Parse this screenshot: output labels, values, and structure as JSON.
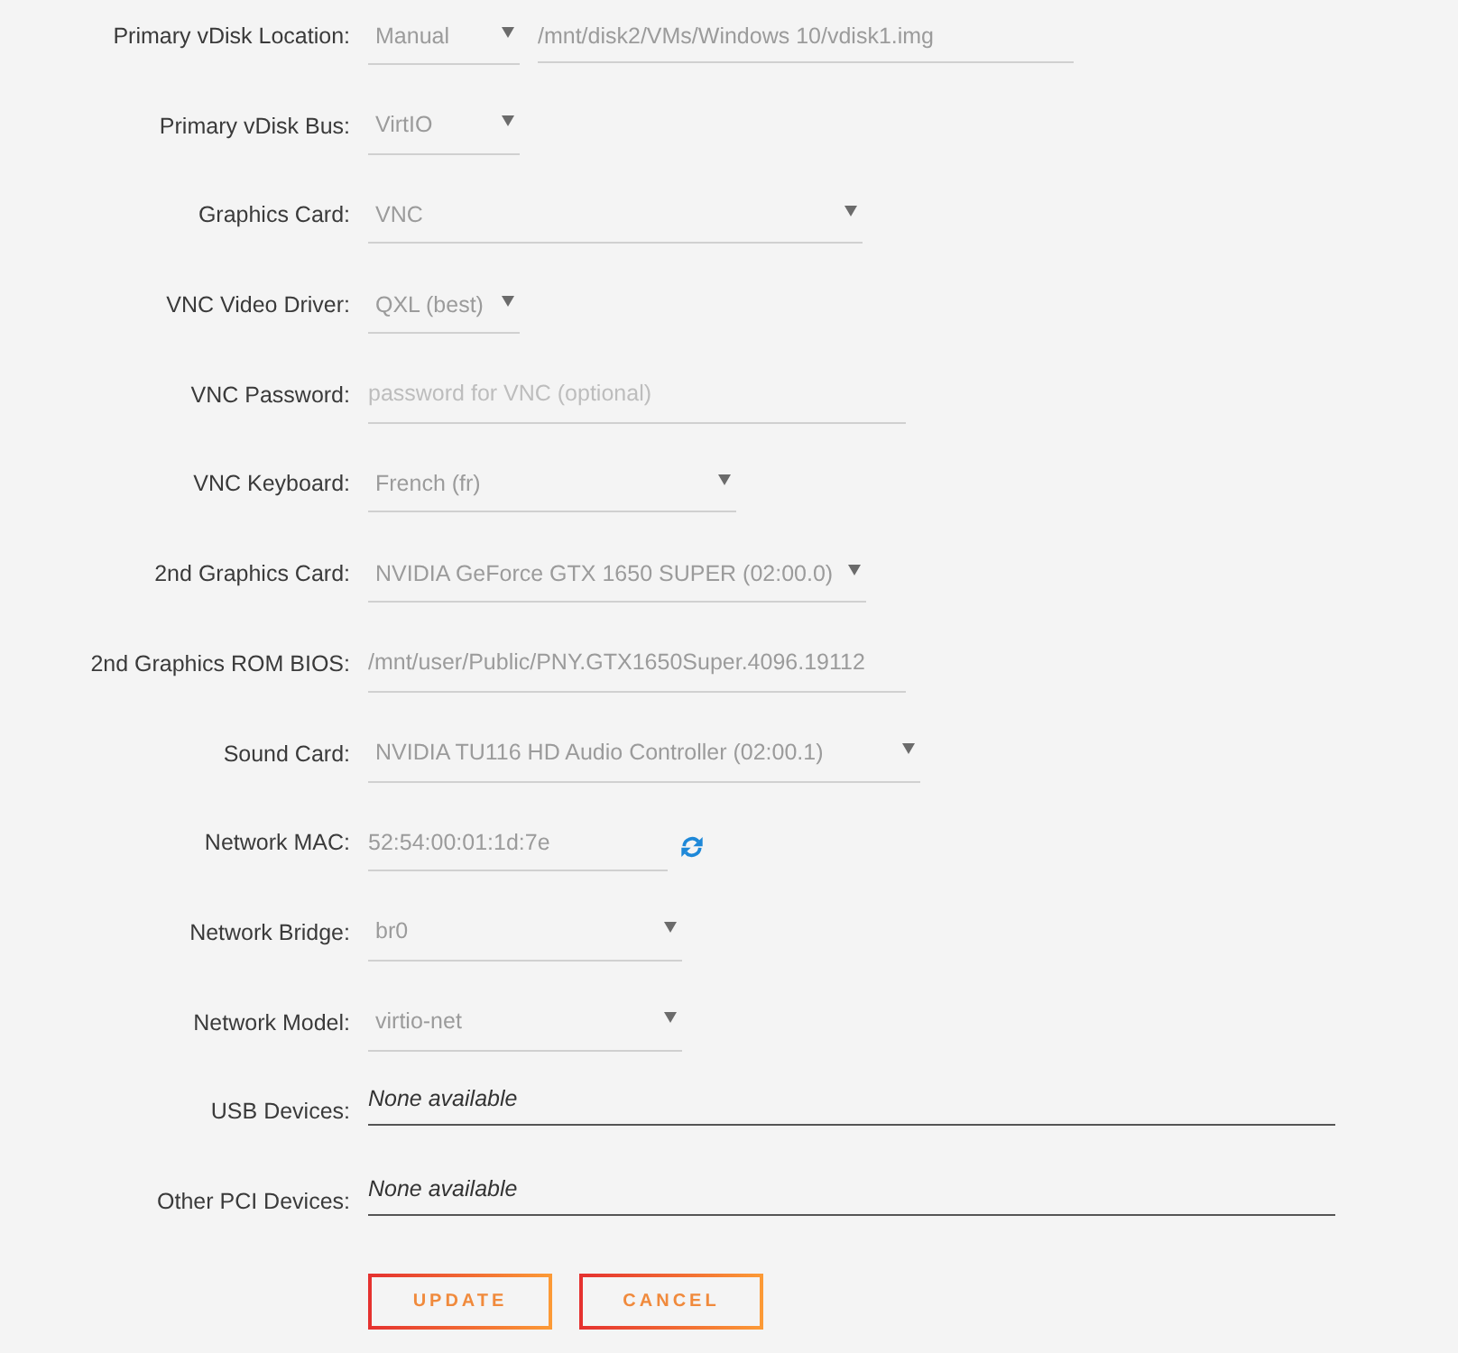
{
  "fields": [
    {
      "kind": "select_path",
      "label": "Primary vDisk Location:",
      "value": "Manual",
      "path": "/mnt/disk2/VMs/Windows 10/vdisk1.img"
    },
    {
      "kind": "select",
      "label": "Primary vDisk Bus:",
      "value": "VirtIO"
    },
    {
      "kind": "select",
      "label": "Graphics Card:",
      "value": "VNC"
    },
    {
      "kind": "select",
      "label": "VNC Video Driver:",
      "value": "QXL (best)"
    },
    {
      "kind": "input",
      "label": "VNC Password:",
      "placeholder": "password for VNC (optional)"
    },
    {
      "kind": "select",
      "label": "VNC Keyboard:",
      "value": "French (fr)"
    },
    {
      "kind": "select",
      "label": "2nd Graphics Card:",
      "value": "NVIDIA GeForce GTX 1650 SUPER (02:00.0)"
    },
    {
      "kind": "input",
      "label": "2nd Graphics ROM BIOS:",
      "value": "/mnt/user/Public/PNY.GTX1650Super.4096.19112"
    },
    {
      "kind": "select",
      "label": "Sound Card:",
      "value": "NVIDIA TU116 HD Audio Controller (02:00.1)"
    },
    {
      "kind": "mac",
      "label": "Network MAC:",
      "value": "52:54:00:01:1d:7e"
    },
    {
      "kind": "select",
      "label": "Network Bridge:",
      "value": "br0"
    },
    {
      "kind": "select",
      "label": "Network Model:",
      "value": "virtio-net"
    },
    {
      "kind": "devices",
      "label": "USB Devices:",
      "value": "None available"
    },
    {
      "kind": "devices",
      "label": "Other PCI Devices:",
      "value": "None available"
    }
  ],
  "buttons": [
    "UPDATE",
    "CANCEL"
  ]
}
